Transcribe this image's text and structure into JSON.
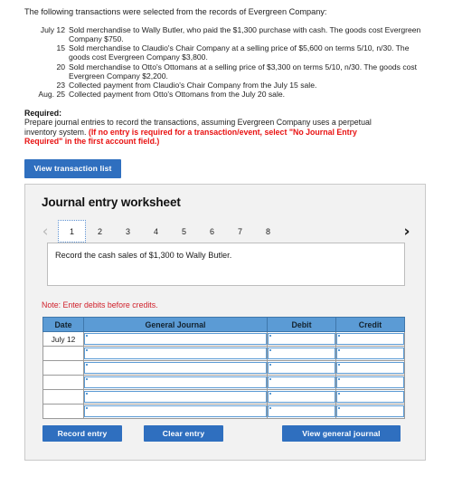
{
  "problem": {
    "intro": "The following transactions were selected from the records of Evergreen Company:",
    "transactions": [
      {
        "date": "July 12",
        "description": "Sold merchandise to Wally Butler, who paid the $1,300 purchase with cash. The goods cost Evergreen Company $750."
      },
      {
        "date": "15",
        "description": "Sold merchandise to Claudio's Chair Company at a selling price of $5,600 on terms 5/10, n/30. The goods cost Evergreen Company $3,800."
      },
      {
        "date": "20",
        "description": "Sold merchandise to Otto's Ottomans at a selling price of $3,300 on terms 5/10, n/30. The goods cost Evergreen Company $2,200."
      },
      {
        "date": "23",
        "description": "Collected payment from Claudio's Chair Company from the July 15 sale."
      },
      {
        "date": "Aug. 25",
        "description": "Collected payment from Otto's Ottomans from the July 20 sale."
      }
    ]
  },
  "required": {
    "label": "Required:",
    "text": "Prepare journal entries to record the transactions, assuming Evergreen Company uses a perpetual inventory system. ",
    "red_text": "(If no entry is required for a transaction/event, select \"No Journal Entry Required\" in the first account field.)"
  },
  "buttons": {
    "view_transaction_list": "View transaction list",
    "record_entry": "Record entry",
    "clear_entry": "Clear entry",
    "view_general_journal": "View general journal"
  },
  "worksheet": {
    "title": "Journal entry worksheet",
    "prev_arrow": "‹",
    "next_arrow": "›",
    "tabs": [
      {
        "label": "1",
        "active": true
      },
      {
        "label": "2",
        "active": false
      },
      {
        "label": "3",
        "active": false
      },
      {
        "label": "4",
        "active": false
      },
      {
        "label": "5",
        "active": false
      },
      {
        "label": "6",
        "active": false
      },
      {
        "label": "7",
        "active": false
      },
      {
        "label": "8",
        "active": false
      }
    ],
    "instruction": "Record the cash sales of $1,300 to Wally Butler.",
    "note": "Note: Enter debits before credits."
  },
  "journal_table": {
    "headers": [
      "Date",
      "General Journal",
      "Debit",
      "Credit"
    ],
    "rows": [
      {
        "date": "July 12",
        "general_journal": "",
        "debit": "",
        "credit": ""
      },
      {
        "date": "",
        "general_journal": "",
        "debit": "",
        "credit": ""
      },
      {
        "date": "",
        "general_journal": "",
        "debit": "",
        "credit": ""
      },
      {
        "date": "",
        "general_journal": "",
        "debit": "",
        "credit": ""
      },
      {
        "date": "",
        "general_journal": "",
        "debit": "",
        "credit": ""
      },
      {
        "date": "",
        "general_journal": "",
        "debit": "",
        "credit": ""
      }
    ]
  },
  "colors": {
    "button_blue": "#2f6fbf",
    "header_blue": "#5b9bd5",
    "alert_red": "#e81111",
    "note_red": "#d0202b",
    "panel_bg": "#f2f2f2"
  }
}
